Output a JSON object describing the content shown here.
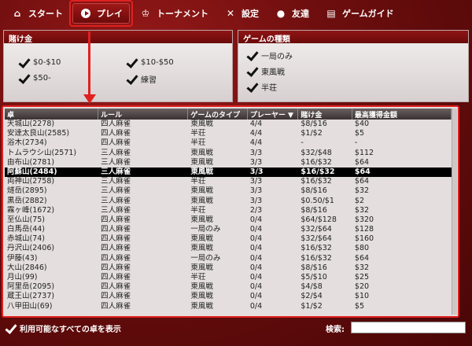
{
  "nav": [
    {
      "label": "スタート",
      "icon": "home-icon"
    },
    {
      "label": "プレイ",
      "icon": "play-icon"
    },
    {
      "label": "トーナメント",
      "icon": "trophy-icon"
    },
    {
      "label": "設定",
      "icon": "tools-icon"
    },
    {
      "label": "友達",
      "icon": "person-icon"
    },
    {
      "label": "ゲームガイド",
      "icon": "book-icon"
    }
  ],
  "stakes_panel": {
    "title": "賭け金",
    "options": [
      "$0-$10",
      "$10-$50",
      "$50-",
      "練習"
    ]
  },
  "type_panel": {
    "title": "ゲームの種類",
    "options": [
      "一局のみ",
      "東風戦",
      "半荘"
    ]
  },
  "table": {
    "headers": [
      "卓",
      "ルール",
      "ゲームのタイプ",
      "プレーヤー",
      "賭け金",
      "最高獲得金額"
    ],
    "sort_indicator": "▼",
    "selected_index": 5,
    "rows": [
      [
        "天城山(2278)",
        "四人麻雀",
        "東風戦",
        "4/4",
        "$8/$16",
        "$40"
      ],
      [
        "安達太良山(2585)",
        "四人麻雀",
        "半荘",
        "4/4",
        "$1/$2",
        "$5"
      ],
      [
        "浴木(2734)",
        "四人麻雀",
        "半荘",
        "4/4",
        "-",
        "-"
      ],
      [
        "トムラウシ山(2571)",
        "三人麻雀",
        "東風戦",
        "3/3",
        "$32/$48",
        "$112"
      ],
      [
        "由布山(2781)",
        "三人麻雀",
        "東風戦",
        "3/3",
        "$16/$32",
        "$64"
      ],
      [
        "阿蘇山(2484)",
        "三人麻雀",
        "東風戦",
        "3/3",
        "$16/$32",
        "$64"
      ],
      [
        "両神山(2758)",
        "三人麻雀",
        "半荘",
        "3/3",
        "$16/$32",
        "$64"
      ],
      [
        "燧岳(2895)",
        "三人麻雀",
        "東風戦",
        "3/3",
        "$8/$16",
        "$32"
      ],
      [
        "黒岳(2882)",
        "三人麻雀",
        "東風戦",
        "3/3",
        "$0.50/$1",
        "$2"
      ],
      [
        "霧ヶ峰(1672)",
        "三人麻雀",
        "半荘",
        "2/3",
        "$8/$16",
        "$32"
      ],
      [
        "至仏山(75)",
        "四人麻雀",
        "東風戦",
        "0/4",
        "$64/$128",
        "$320"
      ],
      [
        "白馬岳(44)",
        "四人麻雀",
        "一局のみ",
        "0/4",
        "$32/$64",
        "$128"
      ],
      [
        "赤城山(74)",
        "四人麻雀",
        "東風戦",
        "0/4",
        "$32/$64",
        "$160"
      ],
      [
        "丹沢山(2406)",
        "四人麻雀",
        "東風戦",
        "0/4",
        "$16/$32",
        "$80"
      ],
      [
        "伊藤(43)",
        "四人麻雀",
        "一局のみ",
        "0/4",
        "$16/$32",
        "$64"
      ],
      [
        "大山(2846)",
        "四人麻雀",
        "東風戦",
        "0/4",
        "$8/$16",
        "$32"
      ],
      [
        "月山(99)",
        "四人麻雀",
        "半荘",
        "0/4",
        "$5/$10",
        "$25"
      ],
      [
        "阿里岳(2095)",
        "四人麻雀",
        "東風戦",
        "0/4",
        "$4/$8",
        "$20"
      ],
      [
        "蔵王山(2737)",
        "四人麻雀",
        "東風戦",
        "0/4",
        "$2/$4",
        "$10"
      ],
      [
        "八甲田山(69)",
        "四人麻雀",
        "東風戦",
        "0/4",
        "$1/$2",
        "$5"
      ]
    ]
  },
  "bottom": {
    "show_all_label": "利用可能なすべての卓を表示",
    "search_label": "検索:",
    "search_value": ""
  }
}
